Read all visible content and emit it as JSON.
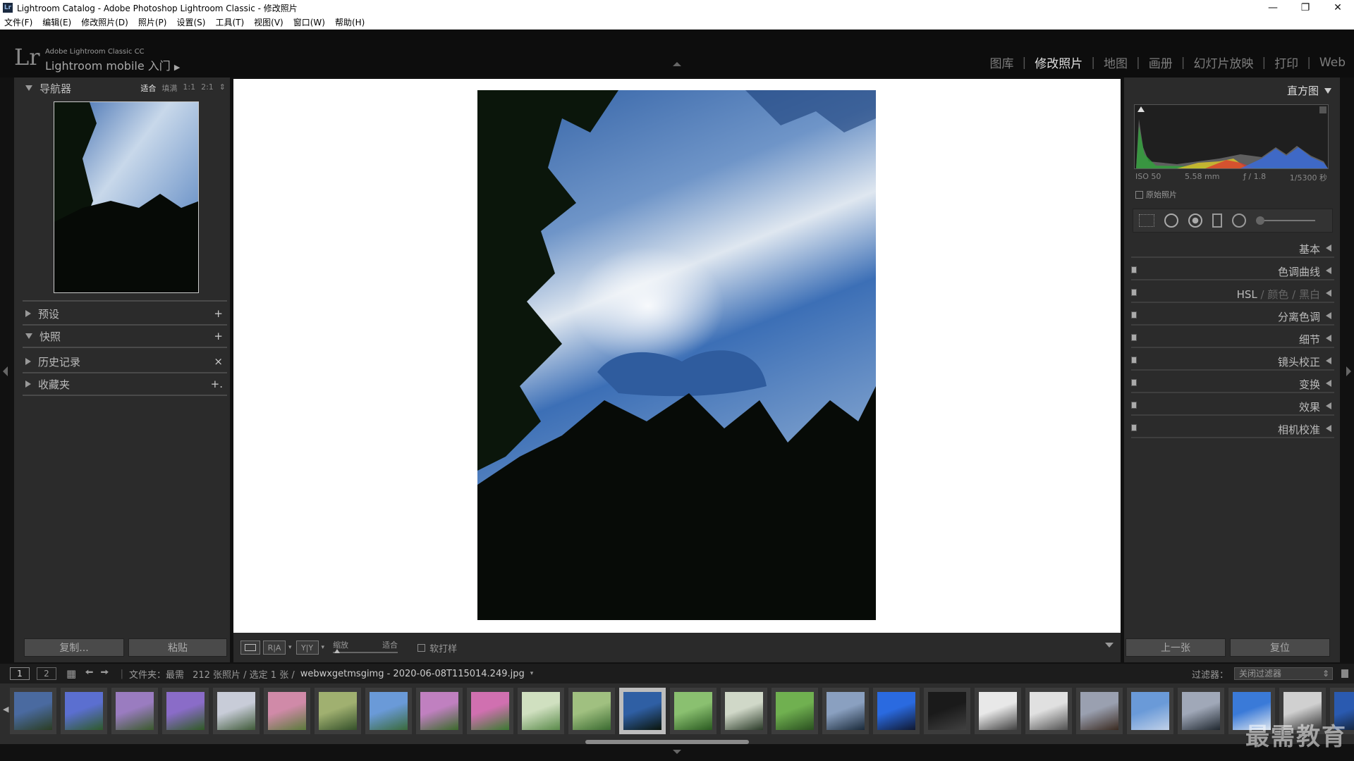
{
  "window": {
    "title": "Lightroom Catalog - Adobe Photoshop Lightroom Classic - 修改照片",
    "app_icon": "Lr"
  },
  "menu": [
    "文件(F)",
    "编辑(E)",
    "修改照片(D)",
    "照片(P)",
    "设置(S)",
    "工具(T)",
    "视图(V)",
    "窗口(W)",
    "帮助(H)"
  ],
  "identity": {
    "logo": "Lr",
    "small": "Adobe Lightroom Classic CC",
    "big": "Lightroom mobile 入门"
  },
  "modules": [
    "图库",
    "修改照片",
    "地图",
    "画册",
    "幻灯片放映",
    "打印",
    "Web"
  ],
  "active_module": "修改照片",
  "left": {
    "navigator": {
      "title": "导航器",
      "opts": [
        "适合",
        "填满",
        "1:1",
        "2:1"
      ],
      "active_opt": "适合"
    },
    "presets": {
      "title": "预设",
      "action": "+"
    },
    "snapshots": {
      "title": "快照",
      "action": "+"
    },
    "history": {
      "title": "历史记录",
      "action": "×"
    },
    "collections": {
      "title": "收藏夹",
      "action": "+."
    },
    "copy_btn": "复制...",
    "paste_btn": "粘贴"
  },
  "toolbar": {
    "zoom_label": "缩放",
    "zoom_value": "适合",
    "softproof": "软打样",
    "ra": "R|A",
    "yy": "Y|Y"
  },
  "right": {
    "histogram_title": "直方图",
    "exif": [
      "ISO 50",
      "5.58 mm",
      "ƒ / 1.8",
      "1/5300 秒"
    ],
    "original": "原始照片",
    "panels": [
      "基本",
      "色调曲线",
      "分离色调",
      "细节",
      "镜头校正",
      "变换",
      "效果",
      "相机校准"
    ],
    "hsl": [
      "HSL",
      "颜色",
      "黑白"
    ],
    "prev_btn": "上一张",
    "reset_btn": "复位"
  },
  "filmbar": {
    "page1": "1",
    "page2": "2",
    "source": "文件夹：最需",
    "count": "212 张照片 / 选定 1 张 /",
    "filename": "webwxgetmsgimg - 2020-06-08T115014.249.jpg",
    "filter_label": "过滤器：",
    "filter_value": "关闭过滤器"
  },
  "watermark": "最需教育",
  "colors": {
    "accent_sky": "#3c6fb6",
    "panel_bg": "#2b2b2b",
    "selected_thumb": "#bdbdbd"
  }
}
